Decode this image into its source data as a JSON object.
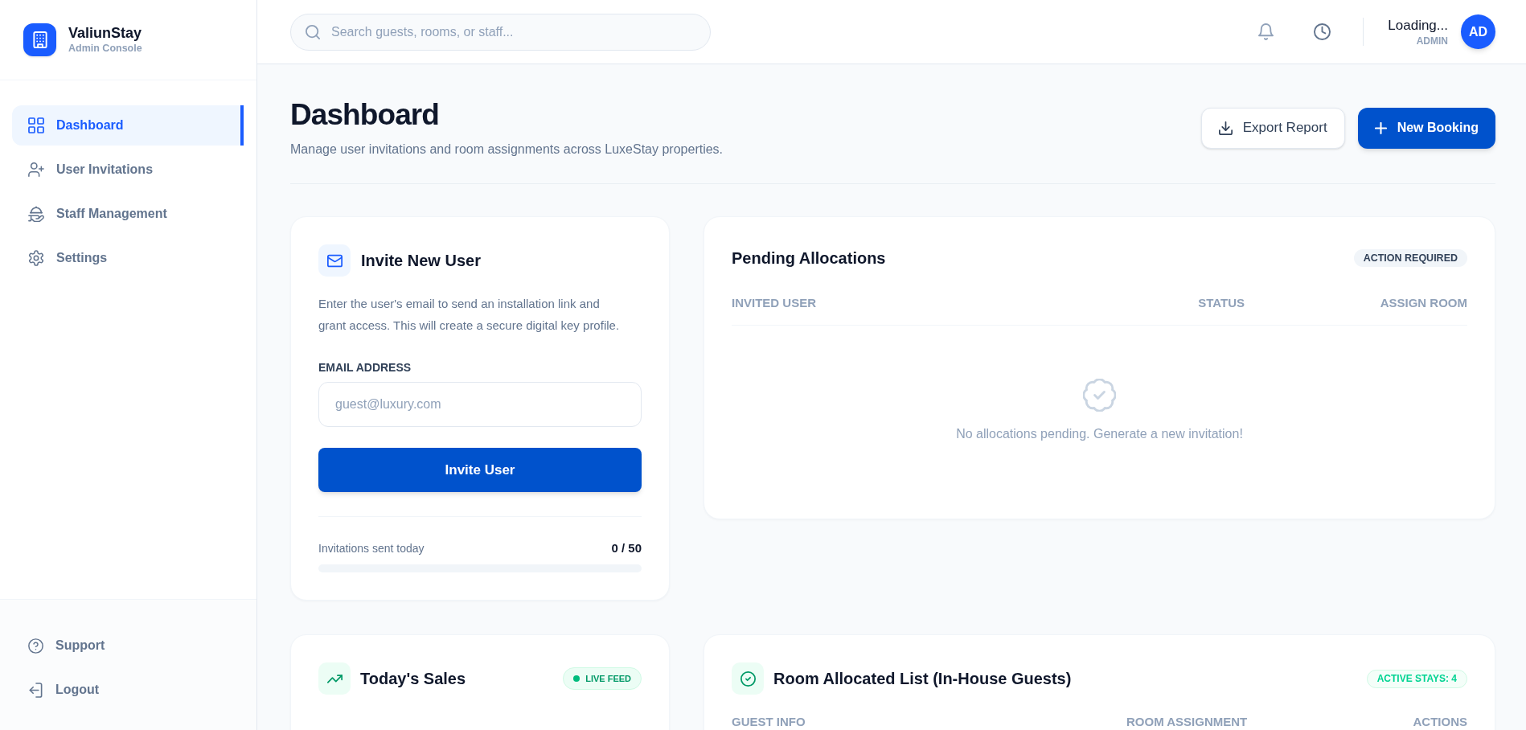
{
  "sidebar": {
    "brand": {
      "name": "ValiunStay",
      "subtitle": "Admin Console"
    },
    "nav": [
      {
        "label": "Dashboard",
        "selected": true
      },
      {
        "label": "User Invitations",
        "selected": false
      },
      {
        "label": "Staff Management",
        "selected": false
      },
      {
        "label": "Settings",
        "selected": false
      }
    ],
    "footer": [
      {
        "label": "Support"
      },
      {
        "label": "Logout"
      }
    ]
  },
  "topbar": {
    "search": {
      "placeholder": "Search guests, rooms, or staff..."
    },
    "user": {
      "name": "Loading...",
      "role": "ADMIN",
      "initials": "AD"
    }
  },
  "header": {
    "title": "Dashboard",
    "subtitle": "Manage user invitations and room assignments across LuxeStay properties.",
    "buttons": [
      {
        "label": "Export Report",
        "kind": "secondary"
      },
      {
        "label": "New Booking",
        "kind": "primary"
      }
    ]
  },
  "invite_card": {
    "title": "Invite New User",
    "description": "Enter the user's email to send an installation link and grant access. This will create a secure digital key profile.",
    "field": {
      "label": "EMAIL ADDRESS",
      "placeholder": "guest@luxury.com"
    },
    "button": "Invite User",
    "quota": {
      "label": "Invitations sent today",
      "count": "0 / 50"
    }
  },
  "pending_allocations": {
    "title": "Pending Allocations",
    "badge": {
      "label": "ACTION REQUIRED",
      "kind": "neutral"
    },
    "columns": [
      "INVITED USER",
      "STATUS",
      "ASSIGN ROOM"
    ],
    "empty_message": "No allocations pending. Generate a new invitation!"
  },
  "todays_sales": {
    "title": "Today's Sales",
    "badge": {
      "label": "LIVE FEED",
      "kind": "live"
    }
  },
  "room_allocated_list": {
    "title": "Room Allocated List (In-House Guests)",
    "badge": {
      "label": "ACTIVE STAYS: 4",
      "kind": "success"
    },
    "columns": [
      "GUEST INFO",
      "ROOM ASSIGNMENT",
      "ACTIONS"
    ]
  }
}
